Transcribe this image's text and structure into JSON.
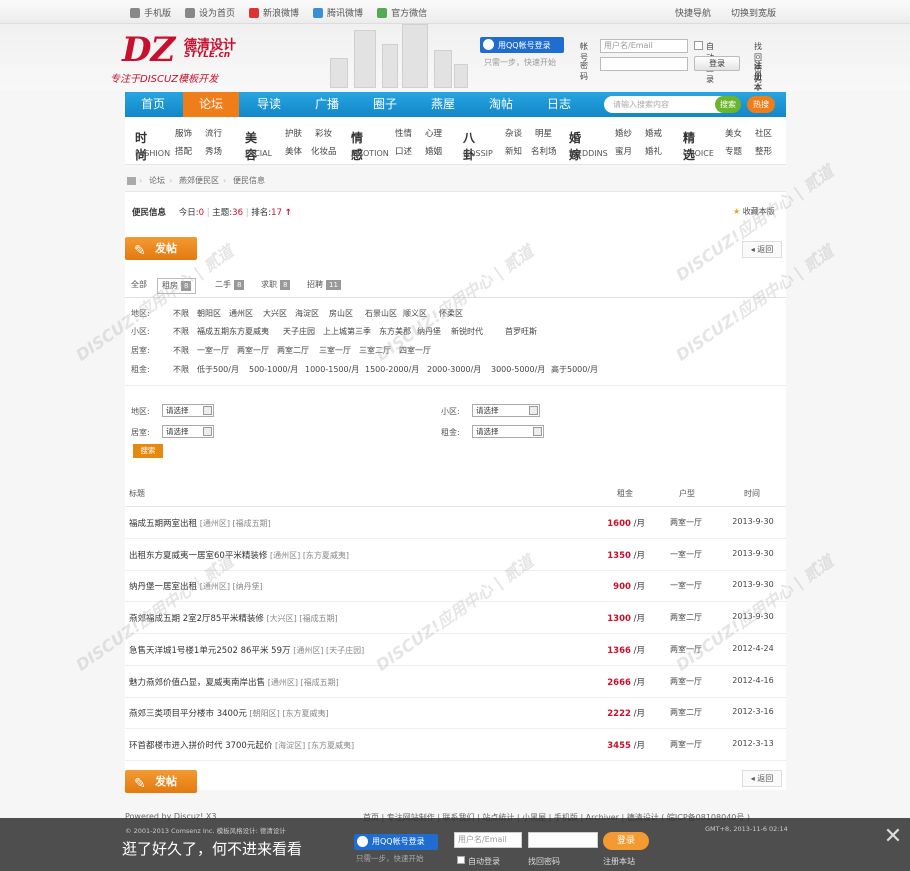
{
  "topbar": {
    "left": [
      "手机版",
      "设为首页",
      "新浪微博",
      "腾讯微博",
      "官方微信"
    ],
    "right": [
      "快捷导航",
      "切换到宽版"
    ]
  },
  "logo": {
    "dz": "DZ",
    "cn": "德清设计",
    "style": "STYLE.cn",
    "slogan": "专注于DISCUZ模板开发"
  },
  "login": {
    "qq_label": "用QQ帐号登录",
    "qq_tip": "只需一步，快速开始",
    "account_label": "帐号",
    "account_placeholder": "用户名/Email",
    "password_label": "密码",
    "auto_login": "自动登录",
    "login_button": "登录",
    "forgot": "找回密码",
    "register": "注册本站"
  },
  "nav": {
    "items": [
      "首页",
      "论坛",
      "导读",
      "广播",
      "圈子",
      "燕屋",
      "淘帖",
      "日志"
    ],
    "search_placeholder": "请输入搜索内容",
    "search_button": "搜索",
    "hot_button": "热搜"
  },
  "subnav": [
    {
      "big": "时尚",
      "en": "FASHION",
      "a": [
        "服饰",
        "流行"
      ],
      "b": [
        "搭配",
        "秀场"
      ]
    },
    {
      "big": "美容",
      "en": "FACIAL",
      "a": [
        "护肤",
        "彩妆"
      ],
      "b": [
        "美体",
        "化妆品"
      ]
    },
    {
      "big": "情感",
      "en": "EMOTION",
      "a": [
        "性情",
        "心理"
      ],
      "b": [
        "口述",
        "婚姻"
      ]
    },
    {
      "big": "八卦",
      "en": "GOSSIP",
      "a": [
        "杂谈",
        "明星"
      ],
      "b": [
        "新知",
        "名利场"
      ]
    },
    {
      "big": "婚嫁",
      "en": "WEDDINS",
      "a": [
        "婚纱",
        "婚戒"
      ],
      "b": [
        "蜜月",
        "婚礼"
      ]
    },
    {
      "big": "精选",
      "en": "CHOICE",
      "a": [
        "美女",
        "社区"
      ],
      "b": [
        "专题",
        "整形"
      ]
    }
  ],
  "breadcrumb": [
    "论坛",
    "燕郊便民区",
    "便民信息"
  ],
  "forum": {
    "name": "便民信息",
    "today_label": "今日:",
    "today": "0",
    "topics_label": "主题:",
    "topics": "36",
    "rank_label": "排名:",
    "rank": "17",
    "favorite": "收藏本版"
  },
  "post_button": "发帖",
  "back_button": "返回",
  "tabs": [
    {
      "label": "全部",
      "count": ""
    },
    {
      "label": "租房",
      "count": "8"
    },
    {
      "label": "二手",
      "count": "8"
    },
    {
      "label": "求职",
      "count": "8"
    },
    {
      "label": "招聘",
      "count": "11"
    }
  ],
  "filters": [
    {
      "label": "地区:",
      "items": [
        "不限",
        "朝阳区",
        "通州区",
        "大兴区",
        "海淀区",
        "房山区",
        "石景山区",
        "顺义区",
        "怀柔区"
      ]
    },
    {
      "label": "小区:",
      "items": [
        "不限",
        "福成五期",
        "东方夏威夷",
        "天子庄园",
        "上上城第三季",
        "东方美郡",
        "纳丹堡",
        "新锐时代",
        "首罗旺斯"
      ]
    },
    {
      "label": "居室:",
      "items": [
        "不限",
        "一室一厅",
        "两室一厅",
        "两室二厅",
        "三室一厅",
        "三室二厅",
        "四室一厅"
      ]
    },
    {
      "label": "租金:",
      "items": [
        "不限",
        "低于500/月",
        "500-1000/月",
        "1000-1500/月",
        "1500-2000/月",
        "2000-3000/月",
        "3000-5000/月",
        "高于5000/月"
      ]
    }
  ],
  "search_form": {
    "region_label": "地区:",
    "community_label": "小区:",
    "room_label": "居室:",
    "rent_label": "租金:",
    "select_placeholder": "请选择",
    "submit": "搜索"
  },
  "table": {
    "headers": [
      "标题",
      "租金",
      "户型",
      "时间"
    ],
    "rows": [
      {
        "title": "福成五期两室出租",
        "tags": "[通州区] [福成五期]",
        "price": "1600",
        "unit": "/月",
        "type": "两室一厅",
        "date": "2013-9-30"
      },
      {
        "title": "出租东方夏威夷一居室60平米精装修",
        "tags": "[通州区] [东方夏威夷]",
        "price": "1350",
        "unit": "/月",
        "type": "一室一厅",
        "date": "2013-9-30"
      },
      {
        "title": "纳丹堡一居室出租",
        "tags": "[通州区] [纳丹堡]",
        "price": "900",
        "unit": "/月",
        "type": "一室一厅",
        "date": "2013-9-30"
      },
      {
        "title": "燕郊福成五期 2室2厅85平米精装修",
        "tags": "[大兴区] [福成五期]",
        "price": "1300",
        "unit": "/月",
        "type": "两室二厅",
        "date": "2013-9-30"
      },
      {
        "title": "急售天洋城1号楼1单元2502 86平米 59万",
        "tags": "[通州区] [天子庄园]",
        "price": "1366",
        "unit": "/月",
        "type": "两室一厅",
        "date": "2012-4-24"
      },
      {
        "title": "魅力燕郊价值凸显，夏威夷南岸出售",
        "tags": "[通州区] [福成五期]",
        "price": "2666",
        "unit": "/月",
        "type": "两室一厅",
        "date": "2012-4-16"
      },
      {
        "title": "燕郊三类项目平分楼市 3400元",
        "tags": "[朝阳区] [东方夏威夷]",
        "price": "2222",
        "unit": "/月",
        "type": "两室二厅",
        "date": "2012-3-16"
      },
      {
        "title": "环首都楼市进入拼价时代 3700元起价",
        "tags": "[海淀区] [东方夏威夷]",
        "price": "3455",
        "unit": "/月",
        "type": "两室一厅",
        "date": "2012-3-13"
      }
    ]
  },
  "footer": {
    "powered": "Powered by Discuz! X3",
    "links": "首页 | 专注网站制作 | 联系我们 | 站点统计 | 小黑屋 | 手机版 | Archiver | 德清设计 ( 皖ICP备08108040号 )",
    "copyright": "© 2001-2013 Comsenz Inc.  模板风格设计: 德清设计",
    "time": "GMT+8, 2013-11-6 02:14"
  },
  "bottom_bar": {
    "slogan": "逛了好久了，何不进来看看",
    "qq_label": "用QQ帐号登录",
    "qq_tip": "只需一步，快速开始",
    "account_placeholder": "用户名/Email",
    "login_button": "登录",
    "auto_login": "自动登录",
    "forgot": "找回密码",
    "register": "注册本站"
  },
  "watermark": {
    "text": "DISCUZ!应用中心 | 贰道",
    "url": "addon.discuz.com"
  },
  "colors": {
    "nav": "#1b96d6",
    "accent": "#ef7d1a",
    "price": "#c8102e"
  }
}
